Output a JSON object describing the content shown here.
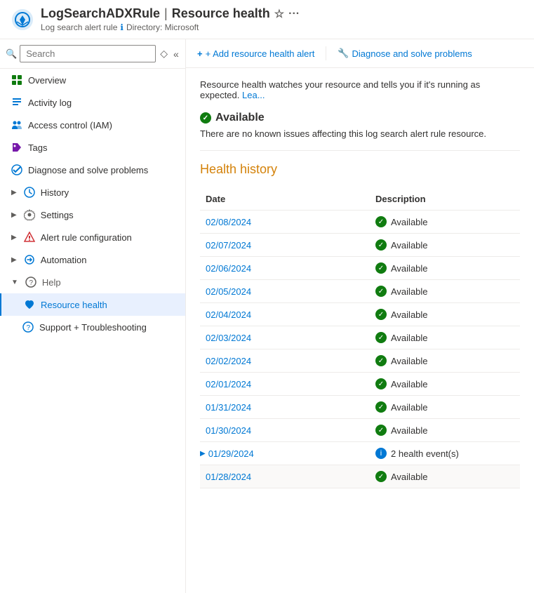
{
  "header": {
    "resource_name": "LogSearchADXRule",
    "separator": "|",
    "page_title": "Resource health",
    "subtitle_type": "Log search alert rule",
    "directory_label": "Directory: Microsoft",
    "info_icon": "ℹ"
  },
  "toolbar": {
    "add_alert_label": "+ Add resource health alert",
    "diagnose_label": "🔧 Diagnose and solve problems"
  },
  "search": {
    "placeholder": "Search"
  },
  "nav": {
    "items": [
      {
        "id": "overview",
        "label": "Overview",
        "icon": "grid"
      },
      {
        "id": "activity-log",
        "label": "Activity log",
        "icon": "list"
      },
      {
        "id": "access-control",
        "label": "Access control (IAM)",
        "icon": "people"
      },
      {
        "id": "tags",
        "label": "Tags",
        "icon": "tag"
      },
      {
        "id": "diagnose",
        "label": "Diagnose and solve problems",
        "icon": "wrench"
      },
      {
        "id": "history",
        "label": "History",
        "icon": "clock",
        "expandable": true
      },
      {
        "id": "settings",
        "label": "Settings",
        "icon": "settings",
        "expandable": true
      },
      {
        "id": "alert-rule-config",
        "label": "Alert rule configuration",
        "icon": "alert",
        "expandable": true
      },
      {
        "id": "automation",
        "label": "Automation",
        "icon": "automation",
        "expandable": true
      },
      {
        "id": "help",
        "label": "Help",
        "icon": "help",
        "collapsible": true,
        "expanded": true
      },
      {
        "id": "resource-health",
        "label": "Resource health",
        "icon": "heart",
        "active": true,
        "subitem": true
      },
      {
        "id": "support-troubleshooting",
        "label": "Support + Troubleshooting",
        "icon": "support",
        "subitem": true
      }
    ]
  },
  "content": {
    "info_text": "Resource health watches your resource and tells you if it's running as expected.",
    "info_link": "Lea...",
    "status_label": "Available",
    "status_desc": "There are no known issues affecting this log search alert rule resource.",
    "health_history_title": "Health history",
    "table": {
      "columns": [
        "Date",
        "Description"
      ],
      "rows": [
        {
          "date": "02/08/2024",
          "description": "Available",
          "status": "available",
          "expandable": false
        },
        {
          "date": "02/07/2024",
          "description": "Available",
          "status": "available",
          "expandable": false
        },
        {
          "date": "02/06/2024",
          "description": "Available",
          "status": "available",
          "expandable": false
        },
        {
          "date": "02/05/2024",
          "description": "Available",
          "status": "available",
          "expandable": false
        },
        {
          "date": "02/04/2024",
          "description": "Available",
          "status": "available",
          "expandable": false
        },
        {
          "date": "02/03/2024",
          "description": "Available",
          "status": "available",
          "expandable": false
        },
        {
          "date": "02/02/2024",
          "description": "Available",
          "status": "available",
          "expandable": false
        },
        {
          "date": "02/01/2024",
          "description": "Available",
          "status": "available",
          "expandable": false
        },
        {
          "date": "01/31/2024",
          "description": "Available",
          "status": "available",
          "expandable": false
        },
        {
          "date": "01/30/2024",
          "description": "Available",
          "status": "available",
          "expandable": false
        },
        {
          "date": "01/29/2024",
          "description": "2 health event(s)",
          "status": "info",
          "expandable": true
        },
        {
          "date": "01/28/2024",
          "description": "Available",
          "status": "available",
          "expandable": false,
          "highlighted": true
        }
      ]
    }
  }
}
